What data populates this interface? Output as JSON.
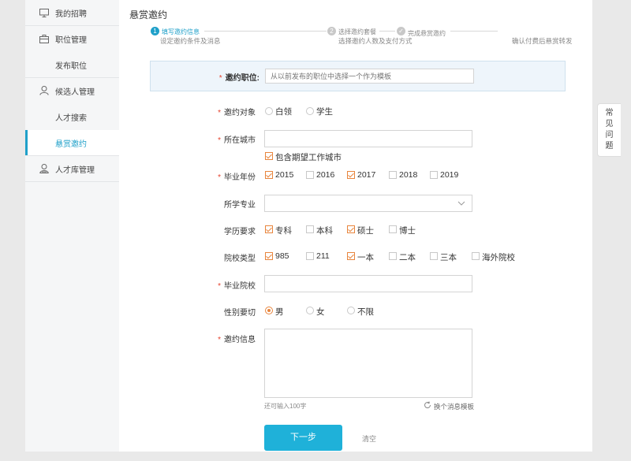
{
  "sidebar": {
    "items": [
      {
        "label": "我的招聘",
        "icon": "monitor-icon"
      },
      {
        "label": "职位管理",
        "icon": "briefcase-icon"
      },
      {
        "label": "发布职位",
        "icon": ""
      },
      {
        "label": "候选人管理",
        "icon": "user-icon"
      },
      {
        "label": "人才搜索",
        "icon": ""
      },
      {
        "label": "悬赏邀约",
        "icon": ""
      },
      {
        "label": "人才库管理",
        "icon": "user-db-icon"
      }
    ],
    "active_index": 5
  },
  "main": {
    "title": "悬赏邀约",
    "steps": [
      {
        "num": "1",
        "title": "填写邀约信息",
        "desc": "设定邀约条件及消息"
      },
      {
        "num": "2",
        "title": "选择邀约套餐",
        "desc": "选择邀约人数及支付方式"
      },
      {
        "num": "✓",
        "title": "完成悬赏邀约",
        "desc": "确认付费后悬赏转发"
      }
    ]
  },
  "form": {
    "position_label": "邀约职位:",
    "position_placeholder": "从以前发布的职位中选择一个作为模板",
    "target_label": "邀约对象",
    "target_options": [
      "白领",
      "学生"
    ],
    "city_label": "所在城市",
    "city_value": "",
    "include_expected_city": "包含期望工作城市",
    "grad_year_label": "毕业年份",
    "grad_years": [
      {
        "label": "2015",
        "checked": true
      },
      {
        "label": "2016",
        "checked": false
      },
      {
        "label": "2017",
        "checked": true
      },
      {
        "label": "2018",
        "checked": false
      },
      {
        "label": "2019",
        "checked": false
      }
    ],
    "major_label": "所学专业",
    "education_label": "学历要求",
    "education": [
      {
        "label": "专科",
        "checked": true
      },
      {
        "label": "本科",
        "checked": false
      },
      {
        "label": "硕士",
        "checked": true
      },
      {
        "label": "博士",
        "checked": false
      }
    ],
    "school_type_label": "院校类型",
    "school_types": [
      {
        "label": "985",
        "checked": true
      },
      {
        "label": "211",
        "checked": false
      },
      {
        "label": "一本",
        "checked": true
      },
      {
        "label": "二本",
        "checked": false
      },
      {
        "label": "三本",
        "checked": false
      },
      {
        "label": "海外院校",
        "checked": false
      }
    ],
    "school_label": "毕业院校",
    "gender_label": "性别要切",
    "genders": [
      {
        "label": "男",
        "selected": true
      },
      {
        "label": "女",
        "selected": false
      },
      {
        "label": "不限",
        "selected": false
      }
    ],
    "message_label": "邀约信息",
    "message_hint": "还可输入100字",
    "change_template": "换个消息模板",
    "next_button": "下一步",
    "clear_link": "清空"
  },
  "faq": {
    "label_lines": [
      "常",
      "见",
      "问",
      "题"
    ]
  },
  "colors": {
    "accent": "#1fa0c9",
    "checkbox": "#e8853d",
    "required": "#e5432f"
  }
}
